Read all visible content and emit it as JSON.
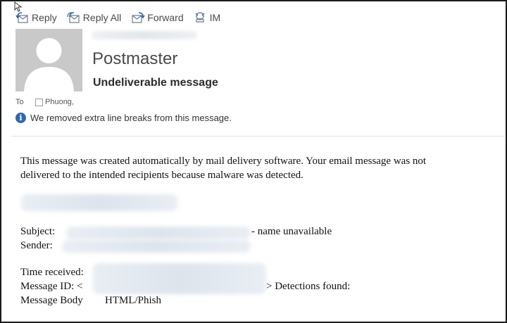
{
  "toolbar": {
    "reply": "Reply",
    "reply_all": "Reply All",
    "forward": "Forward",
    "im": "IM"
  },
  "header": {
    "sender": "Postmaster",
    "subject": "Undeliverable message",
    "to_label": "To",
    "recipient": "Phuong,",
    "info_text": "We removed extra line breaks from this message."
  },
  "body": {
    "line1": "This message was created automatically by mail delivery software. Your email message was not",
    "line2": "delivered to the intended recipients because malware was detected.",
    "subject_label": "Subject:",
    "subject_suffix": "- name unavailable",
    "sender_label": "Sender:",
    "time_received_label": "Time received:",
    "message_id_label": "Message ID: <",
    "detections_label": "> Detections found:",
    "message_body_label": "Message Body",
    "message_body_value": "HTML/Phish"
  },
  "colors": {
    "info_icon": "#2f67b7",
    "toolbar_icon": "#2f67b7",
    "avatar_bg": "#c9c9c9"
  }
}
